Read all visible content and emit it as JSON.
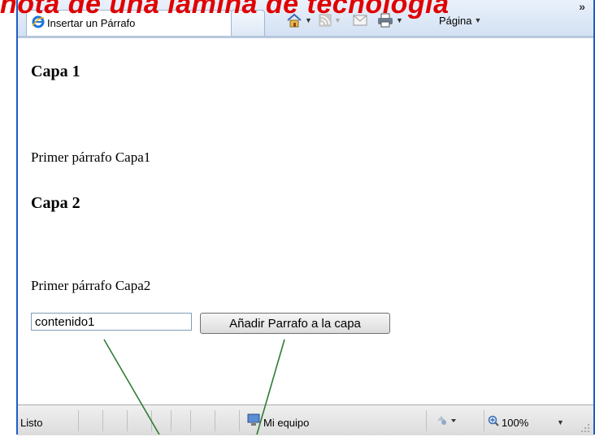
{
  "overlay": {
    "title": "nota de una lámina de tecnología"
  },
  "browser": {
    "tab_label": "Insertar un Párrafo",
    "toolbar": {
      "page_label": "Página",
      "more": "»"
    }
  },
  "content": {
    "heading1": "Capa 1",
    "paragraph1": "Primer párrafo Capa1",
    "heading2": "Capa 2",
    "paragraph2": "Primer párrafo Capa2",
    "input_value": "contenido1",
    "add_button": "Añadir Parrafo a la capa"
  },
  "statusbar": {
    "status": "Listo",
    "zone": "Mi equipo",
    "zoom": "100%"
  },
  "colors": {
    "annotation_line": "#2e7d32",
    "overlay_title": "#e00000",
    "frame": "#1f5cc4"
  }
}
